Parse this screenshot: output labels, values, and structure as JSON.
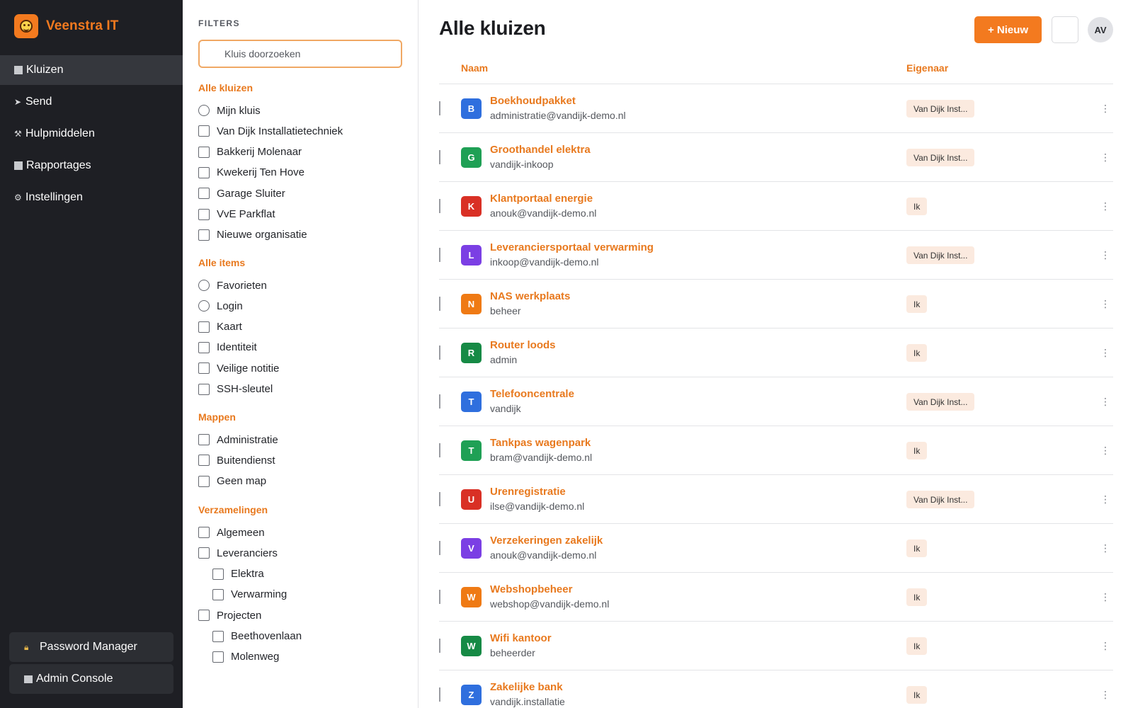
{
  "sidebar": {
    "brand": "Veenstra IT",
    "items": [
      {
        "label": "Kluizen",
        "icon": "square-icon",
        "active": true
      },
      {
        "label": "Send",
        "icon": "send-icon",
        "active": false
      },
      {
        "label": "Hulpmiddelen",
        "icon": "tools-icon",
        "active": false
      },
      {
        "label": "Rapportages",
        "icon": "square-icon",
        "active": false
      },
      {
        "label": "Instellingen",
        "icon": "gear-icon",
        "active": false
      }
    ],
    "bottom": [
      {
        "label": "Password Manager",
        "icon": "lock-icon"
      },
      {
        "label": "Admin Console",
        "icon": "square-icon"
      }
    ]
  },
  "filters": {
    "title": "FILTERS",
    "search_placeholder": "Kluis doorzoeken",
    "sections": [
      {
        "title": "Alle kluizen",
        "items": [
          {
            "label": "Mijn kluis",
            "type": "radio"
          },
          {
            "label": "Van Dijk Installatietechniek",
            "type": "checkbox"
          },
          {
            "label": "Bakkerij Molenaar",
            "type": "checkbox"
          },
          {
            "label": "Kwekerij Ten Hove",
            "type": "checkbox"
          },
          {
            "label": "Garage Sluiter",
            "type": "checkbox"
          },
          {
            "label": "VvE Parkflat",
            "type": "checkbox"
          },
          {
            "label": "Nieuwe organisatie",
            "type": "checkbox"
          }
        ]
      },
      {
        "title": "Alle items",
        "items": [
          {
            "label": "Favorieten",
            "type": "radio"
          },
          {
            "label": "Login",
            "type": "radio"
          },
          {
            "label": "Kaart",
            "type": "checkbox"
          },
          {
            "label": "Identiteit",
            "type": "checkbox"
          },
          {
            "label": "Veilige notitie",
            "type": "checkbox"
          },
          {
            "label": "SSH-sleutel",
            "type": "checkbox"
          }
        ]
      },
      {
        "title": "Mappen",
        "items": [
          {
            "label": "Administratie",
            "type": "checkbox"
          },
          {
            "label": "Buitendienst",
            "type": "checkbox"
          },
          {
            "label": "Geen map",
            "type": "checkbox"
          }
        ]
      },
      {
        "title": "Verzamelingen",
        "items": [
          {
            "label": "Algemeen",
            "type": "checkbox"
          },
          {
            "label": "Leveranciers",
            "type": "checkbox"
          },
          {
            "label": "Elektra",
            "type": "checkbox",
            "indent": true
          },
          {
            "label": "Verwarming",
            "type": "checkbox",
            "indent": true
          },
          {
            "label": "Projecten",
            "type": "checkbox"
          },
          {
            "label": "Beethovenlaan",
            "type": "checkbox",
            "indent": true
          },
          {
            "label": "Molenweg",
            "type": "checkbox",
            "indent": true
          }
        ]
      }
    ]
  },
  "main": {
    "title": "Alle kluizen",
    "new_button": "+ Nieuw",
    "avatar": "AV",
    "columns": {
      "name": "Naam",
      "owner": "Eigenaar"
    },
    "rows": [
      {
        "letter": "B",
        "color": "#2f6fde",
        "name": "Boekhoudpakket",
        "sub": "administratie@vandijk-demo.nl",
        "owner": "Van Dijk Inst..."
      },
      {
        "letter": "G",
        "color": "#1fa055",
        "name": "Groothandel elektra",
        "sub": "vandijk-inkoop",
        "owner": "Van Dijk Inst..."
      },
      {
        "letter": "K",
        "color": "#d93025",
        "name": "Klantportaal energie",
        "sub": "anouk@vandijk-demo.nl",
        "owner": "Ik"
      },
      {
        "letter": "L",
        "color": "#7b3fe4",
        "name": "Leveranciersportaal verwarming",
        "sub": "inkoop@vandijk-demo.nl",
        "owner": "Van Dijk Inst..."
      },
      {
        "letter": "N",
        "color": "#ef7a14",
        "name": "NAS werkplaats",
        "sub": "beheer",
        "owner": "Ik"
      },
      {
        "letter": "R",
        "color": "#168a45",
        "name": "Router loods",
        "sub": "admin",
        "owner": "Ik"
      },
      {
        "letter": "T",
        "color": "#2f6fde",
        "name": "Telefooncentrale",
        "sub": "vandijk",
        "owner": "Van Dijk Inst..."
      },
      {
        "letter": "T",
        "color": "#1fa055",
        "name": "Tankpas wagenpark",
        "sub": "bram@vandijk-demo.nl",
        "owner": "Ik"
      },
      {
        "letter": "U",
        "color": "#d93025",
        "name": "Urenregistratie",
        "sub": "ilse@vandijk-demo.nl",
        "owner": "Van Dijk Inst..."
      },
      {
        "letter": "V",
        "color": "#7b3fe4",
        "name": "Verzekeringen zakelijk",
        "sub": "anouk@vandijk-demo.nl",
        "owner": "Ik"
      },
      {
        "letter": "W",
        "color": "#ef7a14",
        "name": "Webshopbeheer",
        "sub": "webshop@vandijk-demo.nl",
        "owner": "Ik"
      },
      {
        "letter": "W",
        "color": "#168a45",
        "name": "Wifi kantoor",
        "sub": "beheerder",
        "owner": "Ik"
      },
      {
        "letter": "Z",
        "color": "#2f6fde",
        "name": "Zakelijke bank",
        "sub": "vandijk.installatie",
        "owner": "Ik"
      }
    ]
  },
  "colors": {
    "accent": "#f37a1f",
    "sidebar": "#1e1f24"
  }
}
